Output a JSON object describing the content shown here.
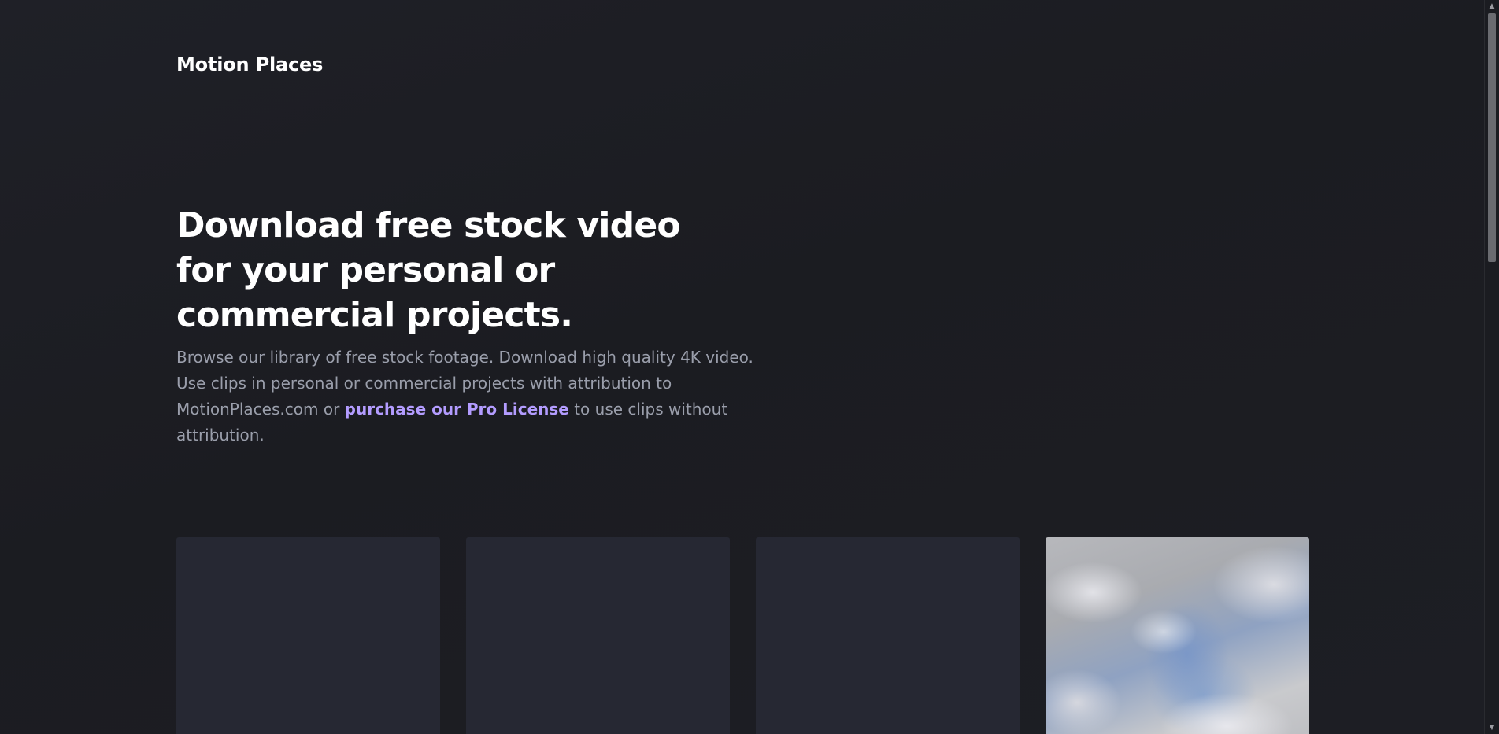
{
  "header": {
    "logo_text": "Motion Places"
  },
  "hero": {
    "title": "Download free stock video for your personal or commercial projects.",
    "description_part1": "Browse our library of free stock footage. Download high quality 4K video. Use clips in personal or commercial projects with attribution to MotionPlaces.com or ",
    "license_link": "purchase our Pro License",
    "description_part2": " to use clips without attribution."
  },
  "videos": {
    "items": [
      {
        "thumbnail": "loading-placeholder"
      },
      {
        "thumbnail": "loading-placeholder"
      },
      {
        "thumbnail": "loading-placeholder"
      },
      {
        "thumbnail": "cloudy-sky"
      }
    ]
  },
  "colors": {
    "background": "#1b1c21",
    "card_placeholder": "#262833",
    "text_muted": "#9a9eab",
    "link_accent": "#b39cff"
  },
  "icons": {
    "scroll_up": "scroll-up-arrow-icon",
    "scroll_down": "scroll-down-arrow-icon"
  }
}
